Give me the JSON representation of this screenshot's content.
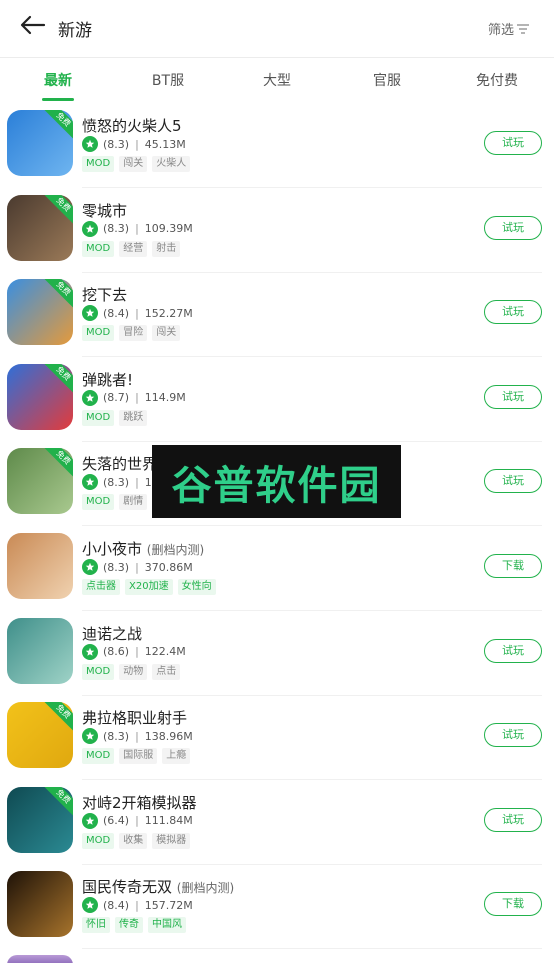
{
  "header": {
    "title": "新游",
    "filter_label": "筛选"
  },
  "tabs": [
    "最新",
    "BT服",
    "大型",
    "官服",
    "免付费"
  ],
  "free_badge": "免费",
  "watermark": "谷普软件园",
  "items": [
    {
      "name": "愤怒的火柴人5",
      "sub": "",
      "rating": "(8.3)",
      "size": "45.13M",
      "tags": [
        "MOD",
        "闯关",
        "火柴人"
      ],
      "button": "试玩",
      "badge": true,
      "icon_colors": [
        "#2b7fd8",
        "#6fb5f0"
      ]
    },
    {
      "name": "零城市",
      "sub": "",
      "rating": "(8.3)",
      "size": "109.39M",
      "tags": [
        "MOD",
        "经营",
        "射击"
      ],
      "button": "试玩",
      "badge": true,
      "icon_colors": [
        "#4a3a2f",
        "#9b7a58"
      ]
    },
    {
      "name": "挖下去",
      "sub": "",
      "rating": "(8.4)",
      "size": "152.27M",
      "tags": [
        "MOD",
        "冒险",
        "闯关"
      ],
      "button": "试玩",
      "badge": true,
      "icon_colors": [
        "#3a8fe0",
        "#e59a3b"
      ]
    },
    {
      "name": "弹跳者!",
      "sub": "",
      "rating": "(8.7)",
      "size": "114.9M",
      "tags": [
        "MOD",
        "跳跃"
      ],
      "button": "试玩",
      "badge": true,
      "icon_colors": [
        "#2f6fd8",
        "#e33b3b"
      ]
    },
    {
      "name": "失落的世界",
      "sub": "",
      "rating": "(8.3)",
      "size": "157",
      "tags": [
        "MOD",
        "剧情"
      ],
      "button": "试玩",
      "badge": true,
      "icon_colors": [
        "#5e8a4a",
        "#a9c98f"
      ]
    },
    {
      "name": "小小夜市",
      "sub": "(删档内测)",
      "rating": "(8.3)",
      "size": "370.86M",
      "tags": [
        "点击器",
        "X20加速",
        "女性向"
      ],
      "button": "下载",
      "badge": false,
      "icon_colors": [
        "#c98a55",
        "#f0d2b0"
      ]
    },
    {
      "name": "迪诺之战",
      "sub": "",
      "rating": "(8.6)",
      "size": "122.4M",
      "tags": [
        "MOD",
        "动物",
        "点击"
      ],
      "button": "试玩",
      "badge": false,
      "icon_colors": [
        "#3f8f8a",
        "#9fd3c7"
      ]
    },
    {
      "name": "弗拉格职业射手",
      "sub": "",
      "rating": "(8.3)",
      "size": "138.96M",
      "tags": [
        "MOD",
        "国际服",
        "上瘾"
      ],
      "button": "试玩",
      "badge": true,
      "icon_colors": [
        "#f2c21a",
        "#e0a80f"
      ]
    },
    {
      "name": "对峙2开箱模拟器",
      "sub": "",
      "rating": "(6.4)",
      "size": "111.84M",
      "tags": [
        "MOD",
        "收集",
        "模拟器"
      ],
      "button": "试玩",
      "badge": true,
      "icon_colors": [
        "#0f4a52",
        "#2b8a93"
      ]
    },
    {
      "name": "国民传奇无双",
      "sub": "(删档内测)",
      "rating": "(8.4)",
      "size": "157.72M",
      "tags": [
        "怀旧",
        "传奇",
        "中国风"
      ],
      "button": "下载",
      "badge": false,
      "icon_colors": [
        "#1e1208",
        "#a8742c"
      ]
    }
  ]
}
